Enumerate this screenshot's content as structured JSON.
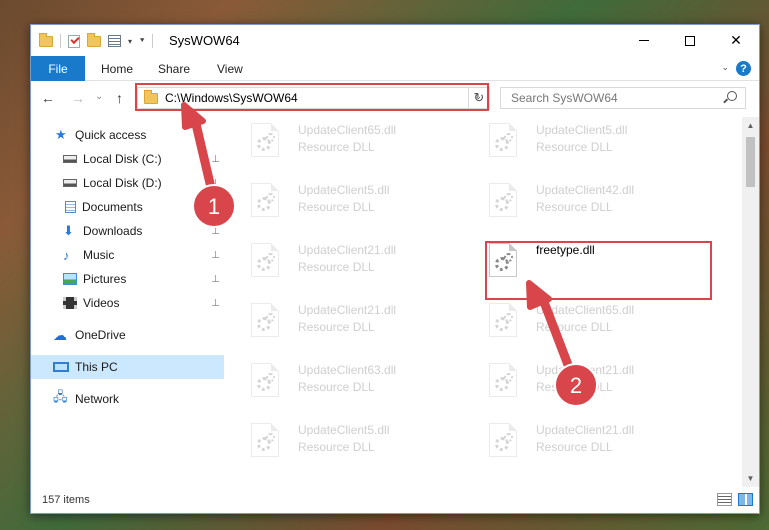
{
  "window": {
    "title": "SysWOW64"
  },
  "quick_access_toolbar": {
    "dropdown_glyph": "▾",
    "customize_glyph": "⯆"
  },
  "window_controls": {
    "minimize": "",
    "maximize": "",
    "close": "✕"
  },
  "ribbon": {
    "tabs": [
      "File",
      "Home",
      "Share",
      "View"
    ],
    "expand_glyph": "⌄",
    "help": "?"
  },
  "navigation": {
    "back": "←",
    "forward": "→",
    "recent": "⌄",
    "up": "↑",
    "address": "C:\\Windows\\SysWOW64",
    "address_dropdown": "⌄",
    "refresh": "↻",
    "search_placeholder": "Search SysWOW64"
  },
  "sidebar": {
    "items": [
      {
        "label": "Quick access",
        "icon": "star-icon",
        "pinned": false
      },
      {
        "label": "Local Disk (C:)",
        "icon": "drive-icon",
        "pinned": true
      },
      {
        "label": "Local Disk (D:)",
        "icon": "drive-icon",
        "pinned": true
      },
      {
        "label": "Documents",
        "icon": "documents-icon",
        "pinned": true
      },
      {
        "label": "Downloads",
        "icon": "downloads-icon",
        "pinned": true
      },
      {
        "label": "Music",
        "icon": "music-icon",
        "pinned": true
      },
      {
        "label": "Pictures",
        "icon": "pictures-icon",
        "pinned": true
      },
      {
        "label": "Videos",
        "icon": "videos-icon",
        "pinned": true
      },
      {
        "label": "OneDrive",
        "icon": "cloud-icon",
        "pinned": false
      },
      {
        "label": "This PC",
        "icon": "computer-icon",
        "pinned": false,
        "selected": true
      },
      {
        "label": "Network",
        "icon": "network-icon",
        "pinned": false
      }
    ],
    "pin_glyph": "📌"
  },
  "files": [
    {
      "name": "UpdateClient65.dll",
      "type": "Resource DLL"
    },
    {
      "name": "UpdateClient5.dll",
      "type": "Resource DLL"
    },
    {
      "name": "UpdateClient5.dll",
      "type": "Resource DLL"
    },
    {
      "name": "UpdateClient42.dll",
      "type": "Resource DLL"
    },
    {
      "name": "UpdateClient21.dll",
      "type": "Resource DLL"
    },
    {
      "name": "freetype.dll",
      "type": "",
      "highlighted": true
    },
    {
      "name": "UpdateClient21.dll",
      "type": "Resource DLL"
    },
    {
      "name": "UpdateClient65.dll",
      "type": "Resource DLL"
    },
    {
      "name": "UpdateClient63.dll",
      "type": "Resource DLL"
    },
    {
      "name": "UpdateClient21.dll",
      "type": "Resource DLL"
    },
    {
      "name": "UpdateClient5.dll",
      "type": "Resource DLL"
    },
    {
      "name": "UpdateClient21.dll",
      "type": "Resource DLL"
    }
  ],
  "status": {
    "item_count": "157 items"
  },
  "annotations": [
    {
      "number": "1",
      "color": "#d8464b"
    },
    {
      "number": "2",
      "color": "#d8464b"
    }
  ]
}
